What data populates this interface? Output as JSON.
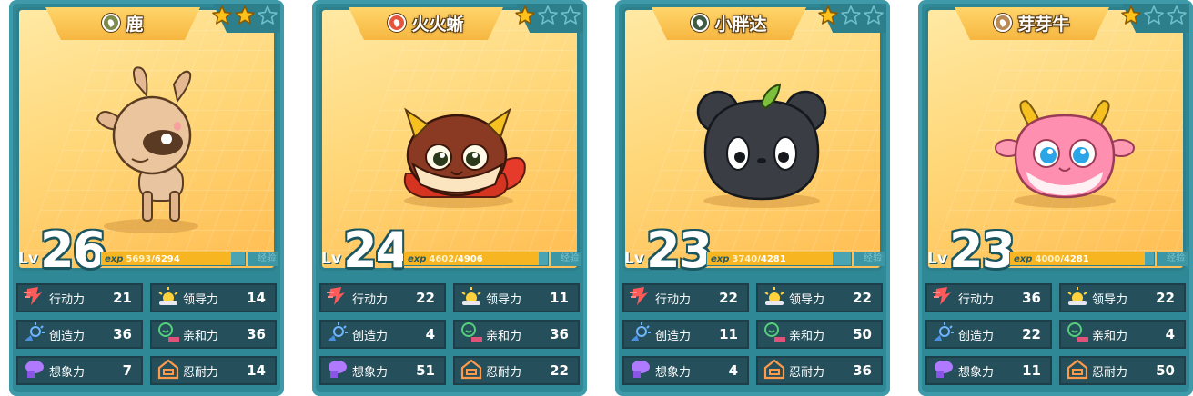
{
  "cards": [
    {
      "name": "鹿",
      "element": "grass",
      "stars": 2,
      "level": "26",
      "lv_label": "Lv",
      "exp_label": "exp",
      "exp_current": "5693",
      "exp_total": "/6294",
      "exp_progress": 0.905,
      "exp_button": "经验",
      "creature": "deer",
      "stats": [
        {
          "label": "行动力",
          "value": "21",
          "icon": "action-icon"
        },
        {
          "label": "领导力",
          "value": "14",
          "icon": "leadership-icon"
        },
        {
          "label": "创造力",
          "value": "36",
          "icon": "creativity-icon"
        },
        {
          "label": "亲和力",
          "value": "36",
          "icon": "affinity-icon"
        },
        {
          "label": "想象力",
          "value": "7",
          "icon": "imagination-icon"
        },
        {
          "label": "忍耐力",
          "value": "14",
          "icon": "endurance-icon"
        }
      ]
    },
    {
      "name": "火火蜥",
      "element": "fire",
      "stars": 1,
      "level": "24",
      "lv_label": "Lv",
      "exp_label": "exp",
      "exp_current": "4602",
      "exp_total": "/4906",
      "exp_progress": 0.938,
      "exp_button": "经验",
      "creature": "fire-lizard",
      "stats": [
        {
          "label": "行动力",
          "value": "22",
          "icon": "action-icon"
        },
        {
          "label": "领导力",
          "value": "11",
          "icon": "leadership-icon"
        },
        {
          "label": "创造力",
          "value": "4",
          "icon": "creativity-icon"
        },
        {
          "label": "亲和力",
          "value": "36",
          "icon": "affinity-icon"
        },
        {
          "label": "想象力",
          "value": "51",
          "icon": "imagination-icon"
        },
        {
          "label": "忍耐力",
          "value": "22",
          "icon": "endurance-icon"
        }
      ]
    },
    {
      "name": "小胖达",
      "element": "dark",
      "stars": 1,
      "level": "23",
      "lv_label": "Lv",
      "exp_label": "exp",
      "exp_current": "3740",
      "exp_total": "/4281",
      "exp_progress": 0.874,
      "exp_button": "经验",
      "creature": "panda",
      "stats": [
        {
          "label": "行动力",
          "value": "22",
          "icon": "action-icon"
        },
        {
          "label": "领导力",
          "value": "22",
          "icon": "leadership-icon"
        },
        {
          "label": "创造力",
          "value": "11",
          "icon": "creativity-icon"
        },
        {
          "label": "亲和力",
          "value": "50",
          "icon": "affinity-icon"
        },
        {
          "label": "想象力",
          "value": "4",
          "icon": "imagination-icon"
        },
        {
          "label": "忍耐力",
          "value": "36",
          "icon": "endurance-icon"
        }
      ]
    },
    {
      "name": "芽芽牛",
      "element": "earth",
      "stars": 1,
      "level": "23",
      "lv_label": "Lv",
      "exp_label": "exp",
      "exp_current": "4000",
      "exp_total": "/4281",
      "exp_progress": 0.934,
      "exp_button": "经验",
      "creature": "cow",
      "stats": [
        {
          "label": "行动力",
          "value": "36",
          "icon": "action-icon"
        },
        {
          "label": "领导力",
          "value": "22",
          "icon": "leadership-icon"
        },
        {
          "label": "创造力",
          "value": "22",
          "icon": "creativity-icon"
        },
        {
          "label": "亲和力",
          "value": "4",
          "icon": "affinity-icon"
        },
        {
          "label": "想象力",
          "value": "11",
          "icon": "imagination-icon"
        },
        {
          "label": "忍耐力",
          "value": "50",
          "icon": "endurance-icon"
        }
      ]
    }
  ],
  "colors": {
    "card_border": "#3e9aa9",
    "art_bg": "#ffd779",
    "stat_bg": "#254f5b",
    "exp_fill": "#f6b521",
    "star_on": "#ffc21a",
    "star_off": "#3e9aa9"
  }
}
